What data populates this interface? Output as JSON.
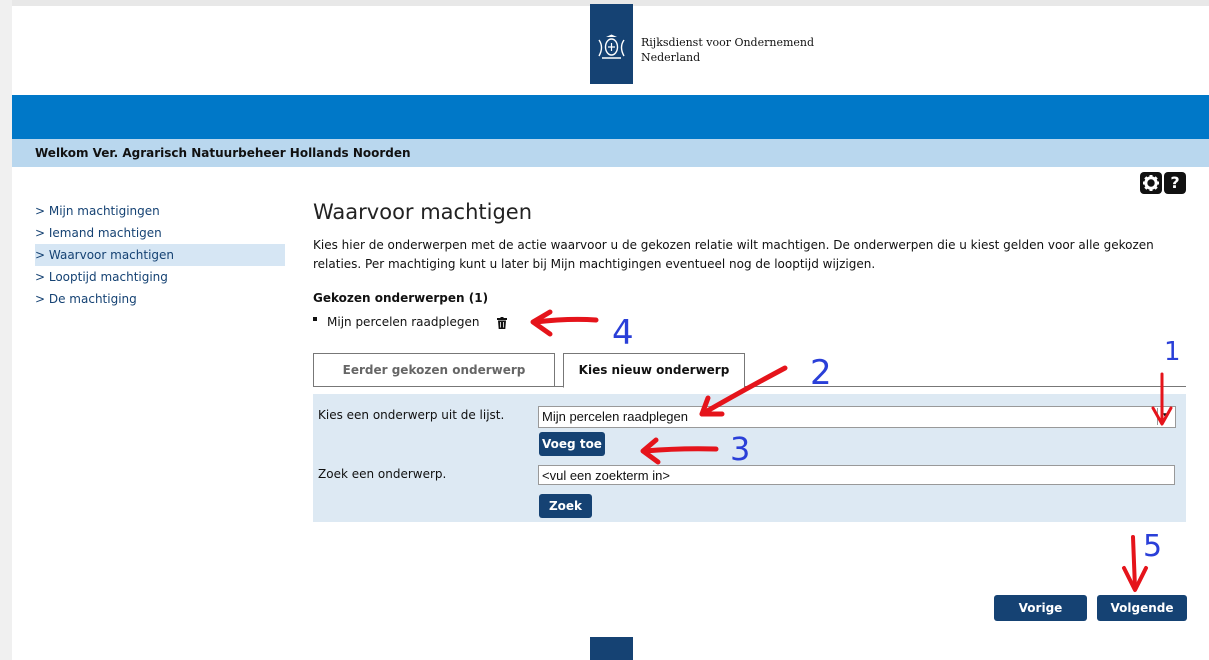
{
  "header": {
    "org_line1": "Rijksdienst voor Ondernemend",
    "org_line2": "Nederland"
  },
  "welcome": "Welkom Ver. Agrarisch Natuurbeheer Hollands Noorden",
  "util": {
    "settings_icon": "gear-icon",
    "help_label": "?"
  },
  "sidenav": {
    "items": [
      {
        "label": "> Mijn machtigingen"
      },
      {
        "label": "> Iemand machtigen"
      },
      {
        "label": "> Waarvoor machtigen",
        "active": true
      },
      {
        "label": "> Looptijd machtiging"
      },
      {
        "label": "> De machtiging"
      }
    ]
  },
  "main": {
    "title": "Waarvoor machtigen",
    "intro": "Kies hier de onderwerpen met de actie waarvoor u de gekozen relatie wilt machtigen. De onderwerpen die u kiest gelden voor alle gekozen relaties. Per machtiging kunt u later bij Mijn machtigingen eventueel nog de looptijd wijzigen.",
    "chosen_heading": "Gekozen onderwerpen (1)",
    "chosen_items": [
      {
        "label": "Mijn percelen raadplegen"
      }
    ],
    "tabs": [
      {
        "label": "Eerder gekozen onderwerp",
        "active": false
      },
      {
        "label": "Kies nieuw onderwerp",
        "active": true
      }
    ],
    "panel": {
      "select_label": "Kies een onderwerp uit de lijst.",
      "select_value": "Mijn percelen raadplegen",
      "add_button": "Voeg toe",
      "search_label": "Zoek een onderwerp.",
      "search_value": "<vul een zoekterm in>",
      "search_button": "Zoek"
    },
    "prev_button": "Vorige",
    "next_button": "Volgende"
  },
  "annotations": {
    "n1": "1",
    "n2": "2",
    "n3": "3",
    "n4": "4",
    "n5": "5"
  }
}
